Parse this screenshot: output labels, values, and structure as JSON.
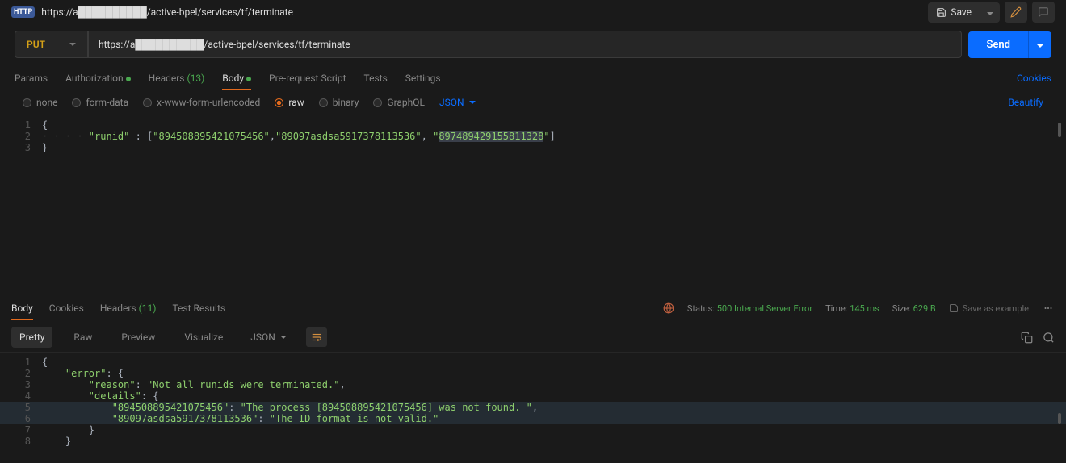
{
  "header": {
    "tab_url": "https://a██████████/active-bpel/services/tf/terminate",
    "save": "Save"
  },
  "request": {
    "method": "PUT",
    "url": "https://a██████████/active-bpel/services/tf/terminate",
    "send": "Send"
  },
  "tabs": {
    "params": "Params",
    "auth": "Authorization",
    "headers": "Headers",
    "headers_count": "(13)",
    "body": "Body",
    "prereq": "Pre-request Script",
    "tests": "Tests",
    "settings": "Settings",
    "cookies": "Cookies"
  },
  "body_types": {
    "none": "none",
    "formdata": "form-data",
    "urlencoded": "x-www-form-urlencoded",
    "raw": "raw",
    "binary": "binary",
    "graphql": "GraphQL",
    "json": "JSON",
    "beautify": "Beautify"
  },
  "request_body": {
    "l1": "{",
    "l2_key": "\"runid\"",
    "l2_mid": " : [",
    "l2_v1": "\"894508895421075456\"",
    "l2_c1": ",",
    "l2_v2": "\"89097asdsa5917378113536\"",
    "l2_c2": ", ",
    "l2_v3_open": "\"",
    "l2_v3_sel": "897489429155811328",
    "l2_v3_close": "\"",
    "l2_end": "]",
    "l3": "}"
  },
  "response_tabs": {
    "body": "Body",
    "cookies": "Cookies",
    "headers": "Headers",
    "headers_count": "(11)",
    "tests": "Test Results"
  },
  "status": {
    "label": "Status:",
    "code": "500",
    "text": "Internal Server Error",
    "time_label": "Time:",
    "time_val": "145 ms",
    "size_label": "Size:",
    "size_val": "629 B",
    "save_example": "Save as example"
  },
  "view_tabs": {
    "pretty": "Pretty",
    "raw": "Raw",
    "preview": "Preview",
    "visualize": "Visualize",
    "json": "JSON"
  },
  "response_body": {
    "l1": "{",
    "l2_k": "\"error\"",
    "l2_r": ": {",
    "l3_k": "\"reason\"",
    "l3_v": "\"Not all runids were terminated.\"",
    "l3_c": ",",
    "l4_k": "\"details\"",
    "l4_r": ": {",
    "l5_k": "\"894508895421075456\"",
    "l5_v": "\"The process [894508895421075456] was not found. \"",
    "l5_c": ",",
    "l6_k": "\"89097asdsa5917378113536\"",
    "l6_v": "\"The ID format is not valid.\"",
    "l7": "}",
    "l8": "}"
  }
}
